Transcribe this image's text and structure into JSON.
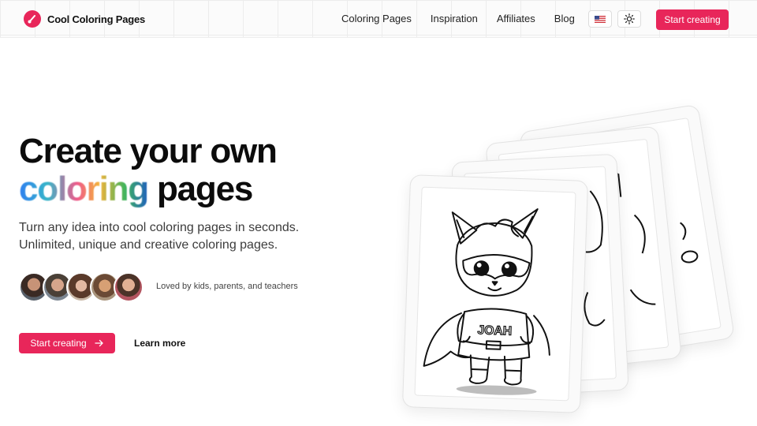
{
  "header": {
    "brand_name": "Cool Coloring Pages",
    "nav": [
      "Coloring Pages",
      "Inspiration",
      "Affiliates",
      "Blog"
    ],
    "language_flag": "us-flag-icon",
    "theme_toggle_icon": "sun-icon",
    "cta_label": "Start creating"
  },
  "hero": {
    "title_line1": "Create your own",
    "title_gradient": "coloring",
    "title_rest": " pages",
    "subtitle": "Turn any idea into cool coloring pages in seconds. Unlimited, unique and creative coloring pages.",
    "loved_by": "Loved by kids, parents, and teachers",
    "cta_label": "Start creating",
    "learn_more": "Learn more"
  },
  "preview": {
    "character_name": "JOAH"
  },
  "colors": {
    "accent": "#e8265a"
  }
}
